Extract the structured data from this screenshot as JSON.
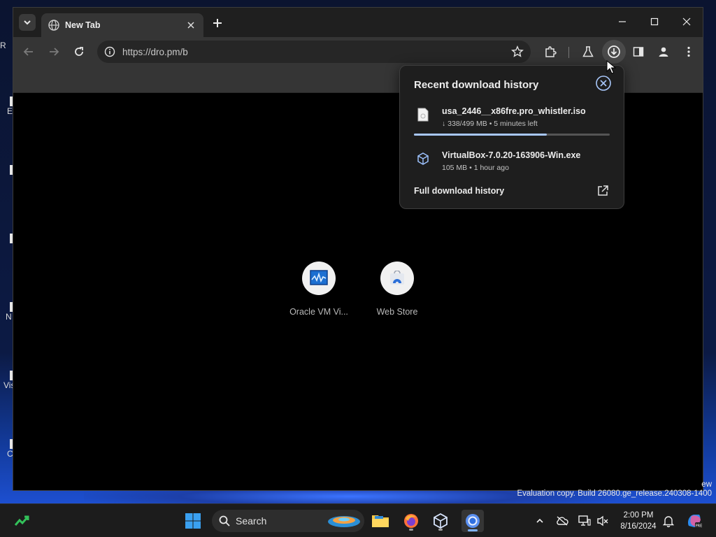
{
  "browser": {
    "tab_title": "New Tab",
    "url": "https://dro.pm/b"
  },
  "shortcuts": [
    {
      "label": "Oracle VM Vi...",
      "icon": "virtualbox-monitor-icon"
    },
    {
      "label": "Web Store",
      "icon": "web-store-icon"
    }
  ],
  "download_panel": {
    "title": "Recent download history",
    "items": [
      {
        "name": "usa_2446__x86fre.pro_whistler.iso",
        "meta": "↓ 338/499 MB • 5 minutes left",
        "icon": "file-icon",
        "progress": 0.68
      },
      {
        "name": "VirtualBox-7.0.20-163906-Win.exe",
        "meta": "105 MB • 1 hour ago",
        "icon": "virtualbox-icon"
      }
    ],
    "footer": "Full download history"
  },
  "desktop": {
    "watermark_line1": "ew",
    "watermark_line2": "Evaluation copy. Build 26080.ge_release.240308-1400",
    "icon_stubs": [
      "R",
      "E",
      "",
      "",
      "N",
      "Vis",
      "C"
    ]
  },
  "taskbar": {
    "search_label": "Search",
    "time": "2:00 PM",
    "date": "8/16/2024"
  },
  "colors": {
    "accent": "#a8c7fa",
    "panel_bg": "#1e1e1e",
    "toolbar_bg": "#353535"
  }
}
